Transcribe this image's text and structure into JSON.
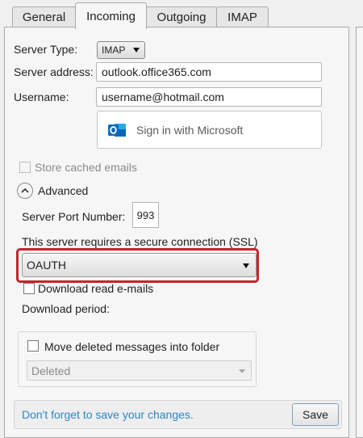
{
  "tabs": [
    "General",
    "Incoming",
    "Outgoing",
    "IMAP"
  ],
  "active_tab": "Incoming",
  "form": {
    "server_type_label": "Server Type:",
    "server_type_value": "IMAP",
    "server_address_label": "Server address:",
    "server_address_value": "outlook.office365.com",
    "username_label": "Username:",
    "username_value": "username@hotmail.com",
    "sign_in_label": "Sign in with Microsoft"
  },
  "options": {
    "store_cached_label": "Store cached emails",
    "advanced_label": "Advanced",
    "port_label": "Server Port Number:",
    "port_value": "993",
    "ssl_label": "This server requires a secure connection (SSL)",
    "ssl_value": "OAUTH",
    "download_read_label": "Download read e-mails",
    "download_period_label": "Download period:",
    "move_deleted_label": "Move deleted messages into folder",
    "deleted_folder_value": "Deleted"
  },
  "footer": {
    "reminder": "Don't forget to save your changes.",
    "save_label": "Save"
  },
  "colors": {
    "highlight": "#c8232c",
    "reminder_text": "#2b86c5",
    "outlook_blue": "#0f6cbd"
  }
}
